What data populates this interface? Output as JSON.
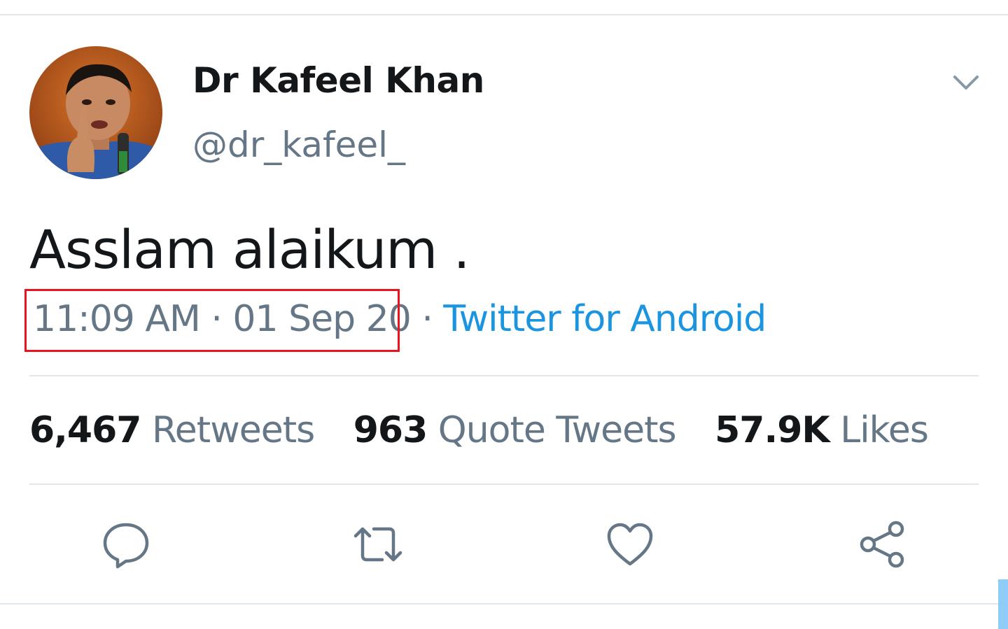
{
  "tweet": {
    "author": {
      "display_name": "Dr Kafeel Khan",
      "handle": "@dr_kafeel_"
    },
    "text": "Asslam alaikum .",
    "timestamp": "11:09 AM · 01 Sep 20",
    "separator": "·",
    "source": "Twitter for Android"
  },
  "stats": {
    "retweets": {
      "count": "6,467",
      "label": "Retweets"
    },
    "quote_tweets": {
      "count": "963",
      "label": "Quote Tweets"
    },
    "likes": {
      "count": "57.9K",
      "label": "Likes"
    }
  },
  "actions": [
    "reply-icon",
    "retweet-icon",
    "like-icon",
    "share-icon"
  ],
  "colors": {
    "text_primary": "#14171a",
    "text_secondary": "#657786",
    "link": "#1b95e0",
    "highlight_box": "#e8141f",
    "divider": "#e1e8ed"
  }
}
